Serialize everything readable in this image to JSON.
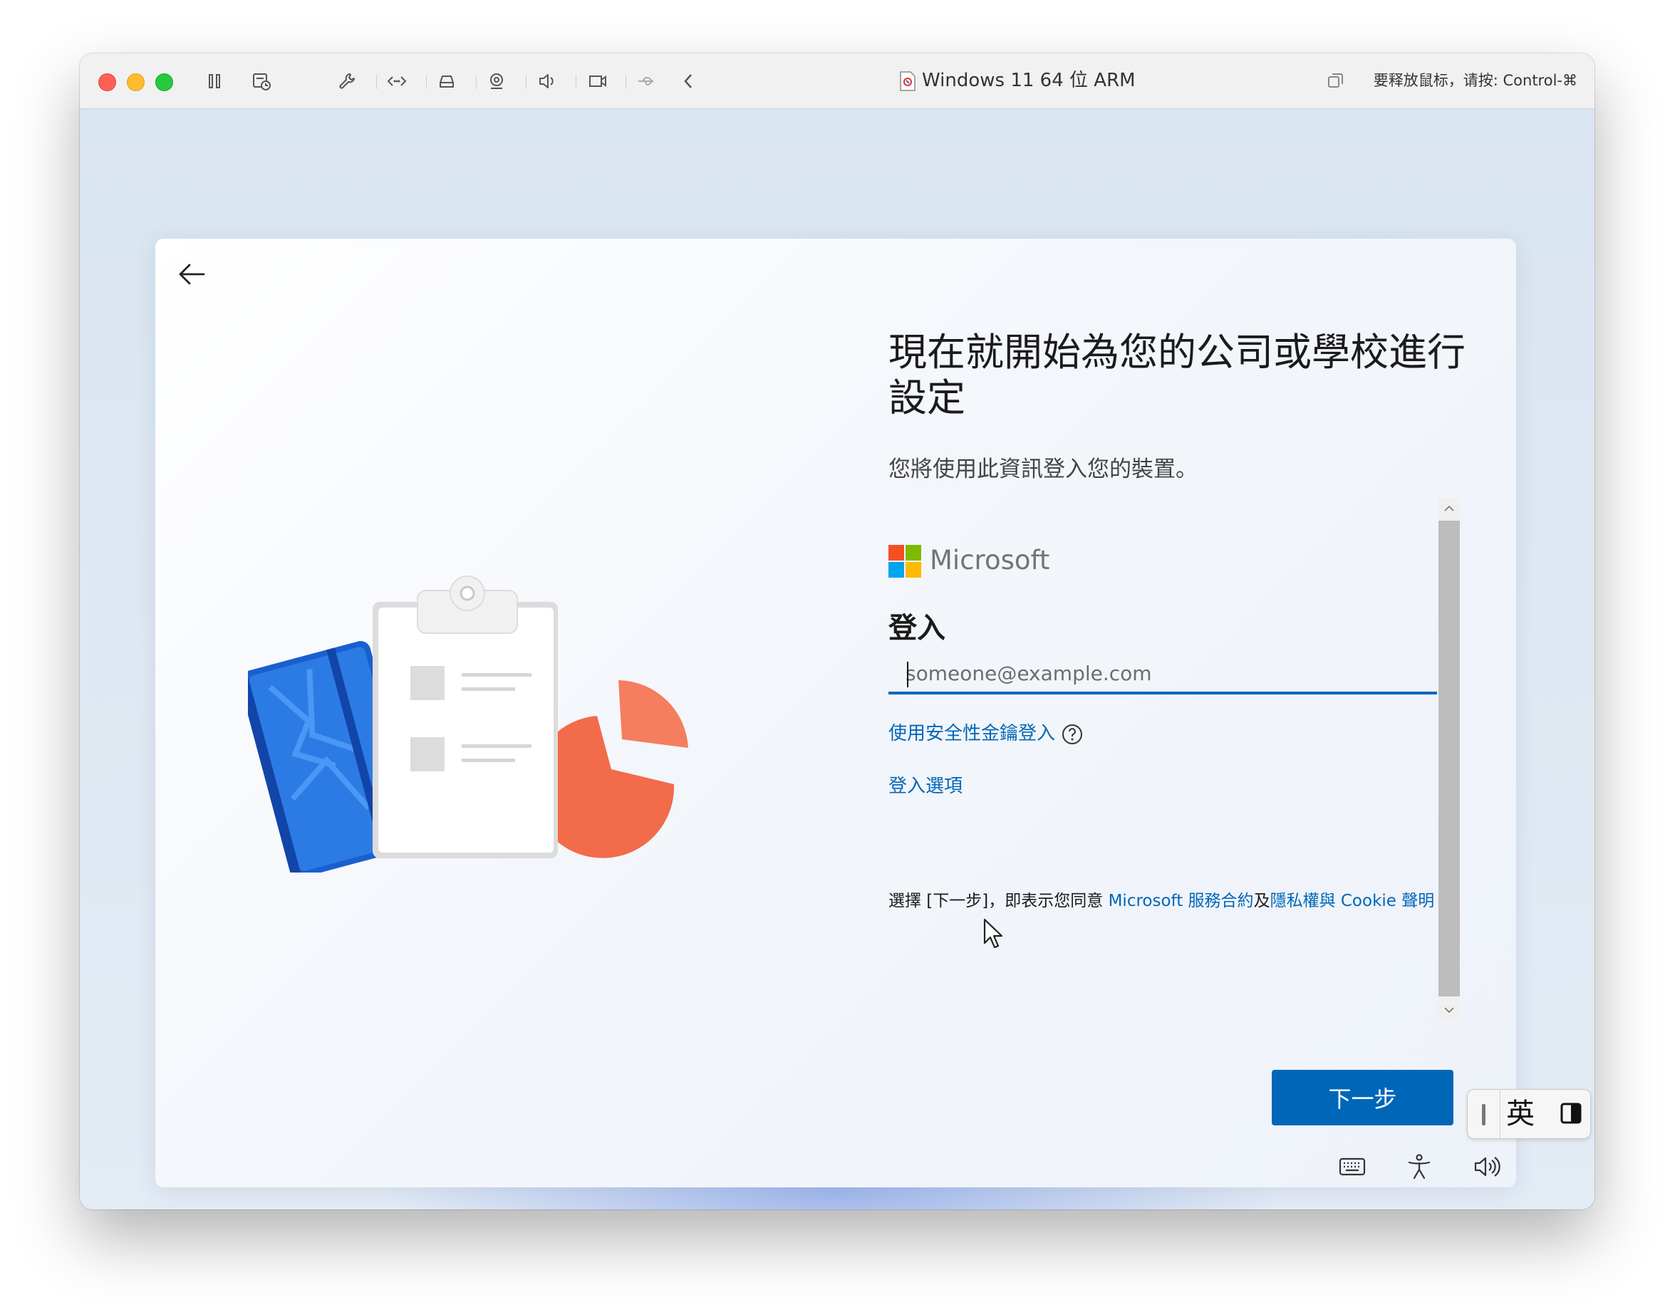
{
  "window": {
    "title": "Windows 11 64 位 ARM",
    "release_hint": "要释放鼠标，请按: Control-⌘"
  },
  "toolbar_icons": [
    "pause-icon",
    "snapshot-icon",
    "wrench-icon",
    "code-icon",
    "disk-icon",
    "camera-icon",
    "speaker-icon",
    "video-icon",
    "usb-icon",
    "chevron-left-icon"
  ],
  "oobe": {
    "heading": "現在就開始為您的公司或學校進行設定",
    "subtext": "您將使用此資訊登入您的裝置。",
    "brand": "Microsoft",
    "signin_title": "登入",
    "email_placeholder": "someone@example.com",
    "security_key_link": "使用安全性金鑰登入",
    "signin_options_link": "登入選項",
    "terms": {
      "prefix": "選擇 [下一步]，即表示您同意 ",
      "service_link": "Microsoft 服務合約",
      "and": "及",
      "privacy_link": "隱私權與 Cookie 聲明"
    },
    "next_button": "下一步"
  },
  "ime": {
    "mode": "英"
  },
  "colors": {
    "accent": "#0067b8",
    "ms_red": "#f25022",
    "ms_green": "#7fba00",
    "ms_blue": "#00a4ef",
    "ms_yellow": "#ffb900"
  }
}
